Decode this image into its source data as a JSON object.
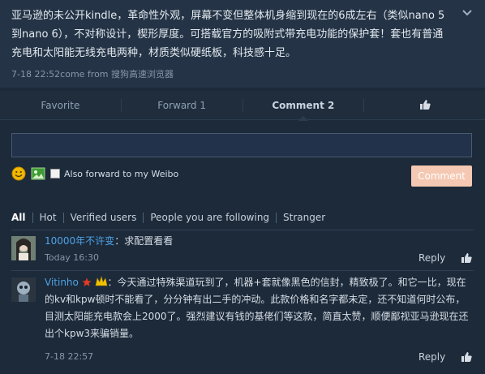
{
  "post": {
    "text": "亚马逊的未公开kindle，革命性外观，屏幕不变但整体机身缩到现在的6成左右（类似nano 5到nano 6），不对称设计，楔形厚度。可搭载官方的吸附式带充电功能的保护套！套也有普通充电和太阳能无线充电两种，材质类似硬纸板，科技感十足。",
    "meta": "7-18 22:52come from 搜狗高速浏览器"
  },
  "actions": {
    "favorite": "Favorite",
    "forward": "Forward 1",
    "comment": "Comment 2"
  },
  "composer": {
    "input_value": "",
    "forward_label": "Also forward to my Weibo",
    "submit_label": "Comment"
  },
  "filters": [
    "All",
    "Hot",
    "Verified users",
    "People you are following",
    "Stranger"
  ],
  "comments": [
    {
      "name": "10000年不许变",
      "text": "：求配置看看",
      "time": "Today 16:30",
      "reply": "Reply"
    },
    {
      "name": "Vitinho",
      "text": "：今天通过特殊渠道玩到了，机器+套就像黑色的信封，精致极了。和它一比，现在的kv和kpw顿时不能看了，分分钟有出二手的冲动。此款价格和名字都未定，还不知道何时公布，目测太阳能充电款会上2000了。强烈建议有钱的基佬们等这款，简直太赞，顺便鄙视亚马逊现在还出个kpw3来骗销量。",
      "time": "7-18 22:57",
      "reply": "Reply"
    }
  ],
  "colors": {
    "background": "#1c2a3a",
    "link": "#4fa3e6",
    "comment_button": "#f4c8b2"
  }
}
